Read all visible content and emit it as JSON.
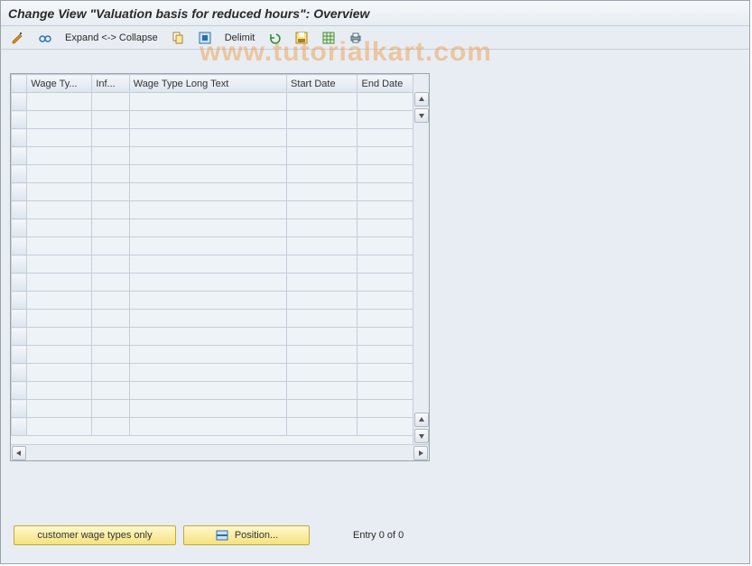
{
  "title": "Change View \"Valuation basis for reduced hours\": Overview",
  "watermark": "www.tutorialkart.com",
  "toolbar": {
    "expand_collapse": "Expand <-> Collapse",
    "delimit": "Delimit"
  },
  "table": {
    "columns": [
      "Wage Ty...",
      "Inf...",
      "Wage Type Long Text",
      "Start Date",
      "End Date"
    ],
    "rows": []
  },
  "footer": {
    "customer_btn": "customer wage types only",
    "position_btn": "Position...",
    "status": "Entry 0 of 0"
  }
}
